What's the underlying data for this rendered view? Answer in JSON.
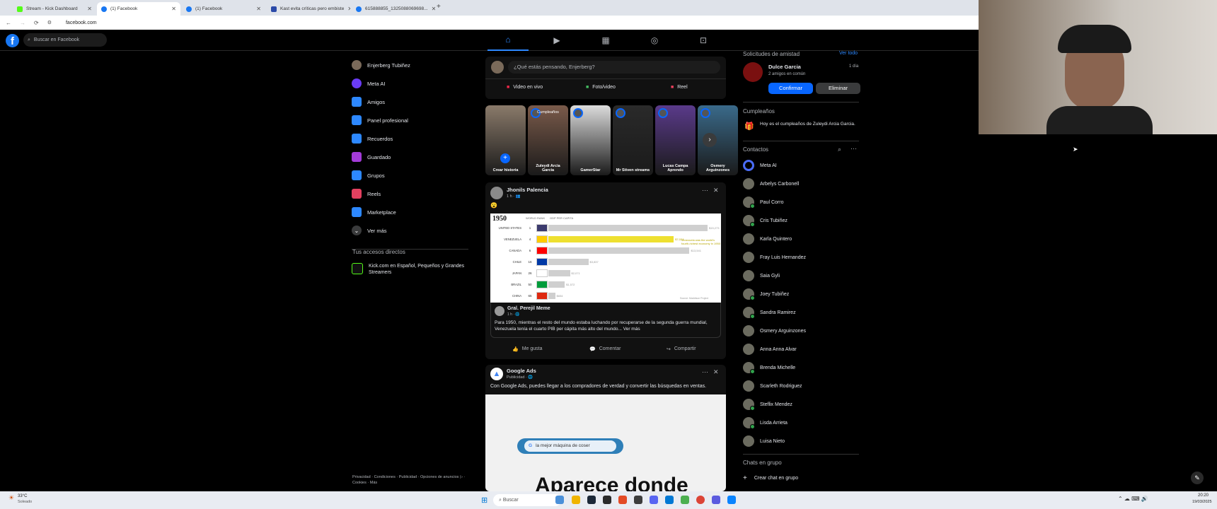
{
  "browser": {
    "tabs": [
      {
        "label": "Stream - Kick Dashboard",
        "color": "#53fc18"
      },
      {
        "label": "(1) Facebook",
        "color": "#1877f2"
      },
      {
        "label": "(1) Facebook",
        "color": "#1877f2"
      },
      {
        "label": "Kast evita críticas pero embiste",
        "color": "#2b4aa8"
      },
      {
        "label": "615888855_1325088069698...",
        "color": "#1877f2"
      }
    ],
    "new_tab": "+",
    "url": "facebook.com"
  },
  "header": {
    "logo": "f",
    "search_placeholder": "Buscar en Facebook"
  },
  "sidebar": {
    "items": [
      {
        "label": "Enjerberg Tubiñez",
        "icon": "avatar",
        "color": "#7a6a5a"
      },
      {
        "label": "Meta AI",
        "icon": "meta-ai-icon",
        "color": "#6a3cf5"
      },
      {
        "label": "Amigos",
        "icon": "friends-icon",
        "color": "#2d88ff"
      },
      {
        "label": "Panel profesional",
        "icon": "dashboard-icon",
        "color": "#2d88ff"
      },
      {
        "label": "Recuerdos",
        "icon": "memories-icon",
        "color": "#2d88ff"
      },
      {
        "label": "Guardado",
        "icon": "saved-icon",
        "color": "#a33bd8"
      },
      {
        "label": "Grupos",
        "icon": "groups-icon",
        "color": "#2d88ff"
      },
      {
        "label": "Reels",
        "icon": "reels-icon",
        "color": "#e4405f"
      },
      {
        "label": "Marketplace",
        "icon": "marketplace-icon",
        "color": "#2d88ff"
      },
      {
        "label": "Ver más",
        "icon": "chevron-down-icon",
        "color": "#3a3b3c"
      }
    ],
    "shortcuts_title": "Tus accesos directos",
    "shortcut": "Kick.com en Español, Pequeños y Grandes Streamers",
    "footer": "Privacidad · Condiciones · Publicidad · Opciones de anuncios ▷ · Cookies · Más"
  },
  "composer": {
    "placeholder": "¿Qué estás pensando, Enjerberg?",
    "live": "Video en vivo",
    "photo": "Foto/video",
    "reel": "Reel"
  },
  "stories": [
    {
      "label": "Crear historia",
      "top": "",
      "color": "#8a7a6a"
    },
    {
      "label": "Zuleydi Arcia Garcia",
      "top": "Cumpleaños",
      "color": "#7a5a4a"
    },
    {
      "label": "GamerStar",
      "top": "",
      "color": "#dcdcdc"
    },
    {
      "label": "Mr Stiven streams",
      "top": "",
      "color": "#2a2a2a"
    },
    {
      "label": "Lucas Campa Aprendo",
      "top": "",
      "color": "#5a3a8a"
    },
    {
      "label": "Osmery Arguinzones",
      "top": "",
      "color": "#3a6a8a"
    }
  ],
  "post1": {
    "author": "Jhonils Palencia",
    "meta": "1 h · 👥",
    "emoji": "😮",
    "shared_author": "Gral. Perejil Meme",
    "shared_meta": "1 h · 🌐",
    "text": "Para 1950, mientras el resto del mundo estaba luchando por recuperarse de la segunda guerra mundial, Venezuela tenía el cuarto PIB per cápita más alto del mundo... Ver más",
    "like": "Me gusta",
    "comment": "Comentar",
    "share": "Compartir"
  },
  "chart_data": {
    "type": "bar",
    "title": "1950",
    "xlabel": "",
    "ylabel": "GDP PER CAPITA",
    "col_rank": "WORLD RANK",
    "categories": [
      "UNITED STATES",
      "VENEZUELA",
      "CANADA",
      "CHILE",
      "JAPAN",
      "BRAZIL",
      "CHINA"
    ],
    "ranks": [
      "1",
      "4",
      "6",
      "16",
      "26",
      "50",
      "65"
    ],
    "values": [
      15273,
      12024,
      13541,
      3837,
      2071,
      1572,
      654
    ],
    "value_labels": [
      "$15,273",
      "$7,024",
      "$13,541",
      "$3,837",
      "$2,071",
      "$1,572",
      "$654"
    ],
    "highlight": "VENEZUELA",
    "note": "Venezuela was the world's fourth-richest economy in 1950",
    "source": "Source: Maddison Project"
  },
  "post2": {
    "author": "Google Ads",
    "meta": "Publicidad · 🌐",
    "text": "Con Google Ads, puedes llegar a los compradores de verdad y convertir las búsquedas en ventas.",
    "search_text": "la mejor máquina de coser",
    "big_text": "Aparece donde"
  },
  "right": {
    "friend_requests": "Solicitudes de amistad",
    "see_all": "Ver todo",
    "req_name": "Dulce Garcia",
    "req_time": "1 día",
    "req_mutual": "2 amigos en común",
    "confirm": "Confirmar",
    "delete": "Eliminar",
    "birthdays": "Cumpleaños",
    "birthday_text": "Hoy es el cumpleaños de Zuleydi Arcia Garcia.",
    "contacts_title": "Contactos",
    "contacts": [
      {
        "name": "Meta AI",
        "online": false
      },
      {
        "name": "Arbelys Carbonell",
        "online": false
      },
      {
        "name": "Paul Corro",
        "online": true
      },
      {
        "name": "Cris Tubiñez",
        "online": true
      },
      {
        "name": "Karla Quintero",
        "online": false
      },
      {
        "name": "Fray Luis Hernandez",
        "online": false
      },
      {
        "name": "Saia Gyli",
        "online": false
      },
      {
        "name": "Joey Tubiñez",
        "online": true
      },
      {
        "name": "Sandra Ramirez",
        "online": true
      },
      {
        "name": "Osmery Arguinzones",
        "online": false
      },
      {
        "name": "Anna Anna Alvar",
        "online": false
      },
      {
        "name": "Brenda Michelle",
        "online": true
      },
      {
        "name": "Scarleth Rodriguez",
        "online": false
      },
      {
        "name": "Steflix Mendez",
        "online": true
      },
      {
        "name": "Lisda Arrieta",
        "online": true
      },
      {
        "name": "Luisa Nieto",
        "online": false
      }
    ],
    "group_chats": "Chats en grupo",
    "create_group": "Crear chat en grupo"
  },
  "taskbar": {
    "weather_temp": "33°C",
    "weather_text": "Soleado",
    "search": "Buscar",
    "time": "20:20",
    "date": "19/03/2025"
  }
}
